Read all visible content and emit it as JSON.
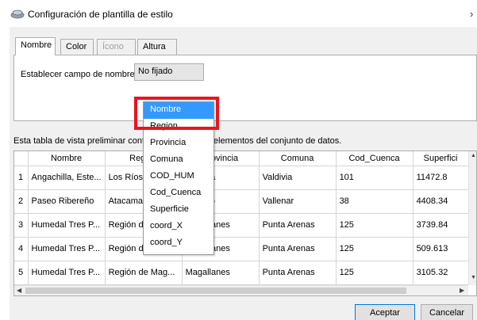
{
  "window": {
    "title": "Configuración de plantilla de estilo",
    "icon": "style-template-icon",
    "close_label": "›"
  },
  "tabs": [
    {
      "label": "Nombre",
      "state": "active"
    },
    {
      "label": "Color",
      "state": "normal"
    },
    {
      "label": "Ícono",
      "state": "disabled"
    },
    {
      "label": "Altura",
      "state": "normal"
    }
  ],
  "name_field": {
    "label": "Establecer campo de nombre:",
    "combo_value": "No fijado"
  },
  "dropdown": {
    "items": [
      "Nombre",
      "Region",
      "Provincia",
      "Comuna",
      "COD_HUM",
      "Cod_Cuenca",
      "Superficie",
      "coord_X",
      "coord_Y"
    ],
    "selected": "Nombre"
  },
  "preview": {
    "label": "Esta tabla de vista preliminar contiene los primeros elementos del conjunto de datos.",
    "columns": [
      "",
      "Nombre",
      "Region",
      "Provincia",
      "Comuna",
      "Cod_Cuenca",
      "Superfici"
    ],
    "rows": [
      [
        "1",
        "Angachilla, Este...",
        "Los Ríos",
        "Valdivia",
        "Valdivia",
        "101",
        "11472.8"
      ],
      [
        "2",
        "Paseo Ribereño",
        "Atacama",
        "Huasco",
        "Vallenar",
        "38",
        "4408.34"
      ],
      [
        "3",
        "Humedal Tres P...",
        "Región de Mag...",
        "Magallanes",
        "Punta Arenas",
        "125",
        "3739.84"
      ],
      [
        "4",
        "Humedal Tres P...",
        "Región de Mag...",
        "Magallanes",
        "Punta Arenas",
        "125",
        "509.613"
      ],
      [
        "5",
        "Humedal Tres P...",
        "Región de Mag...",
        "Magallanes",
        "Punta Arenas",
        "125",
        "3105.32"
      ]
    ]
  },
  "buttons": {
    "accept": "Aceptar",
    "cancel": "Cancelar"
  },
  "colors": {
    "highlight": "#e8151f",
    "selection": "#3399ff"
  }
}
